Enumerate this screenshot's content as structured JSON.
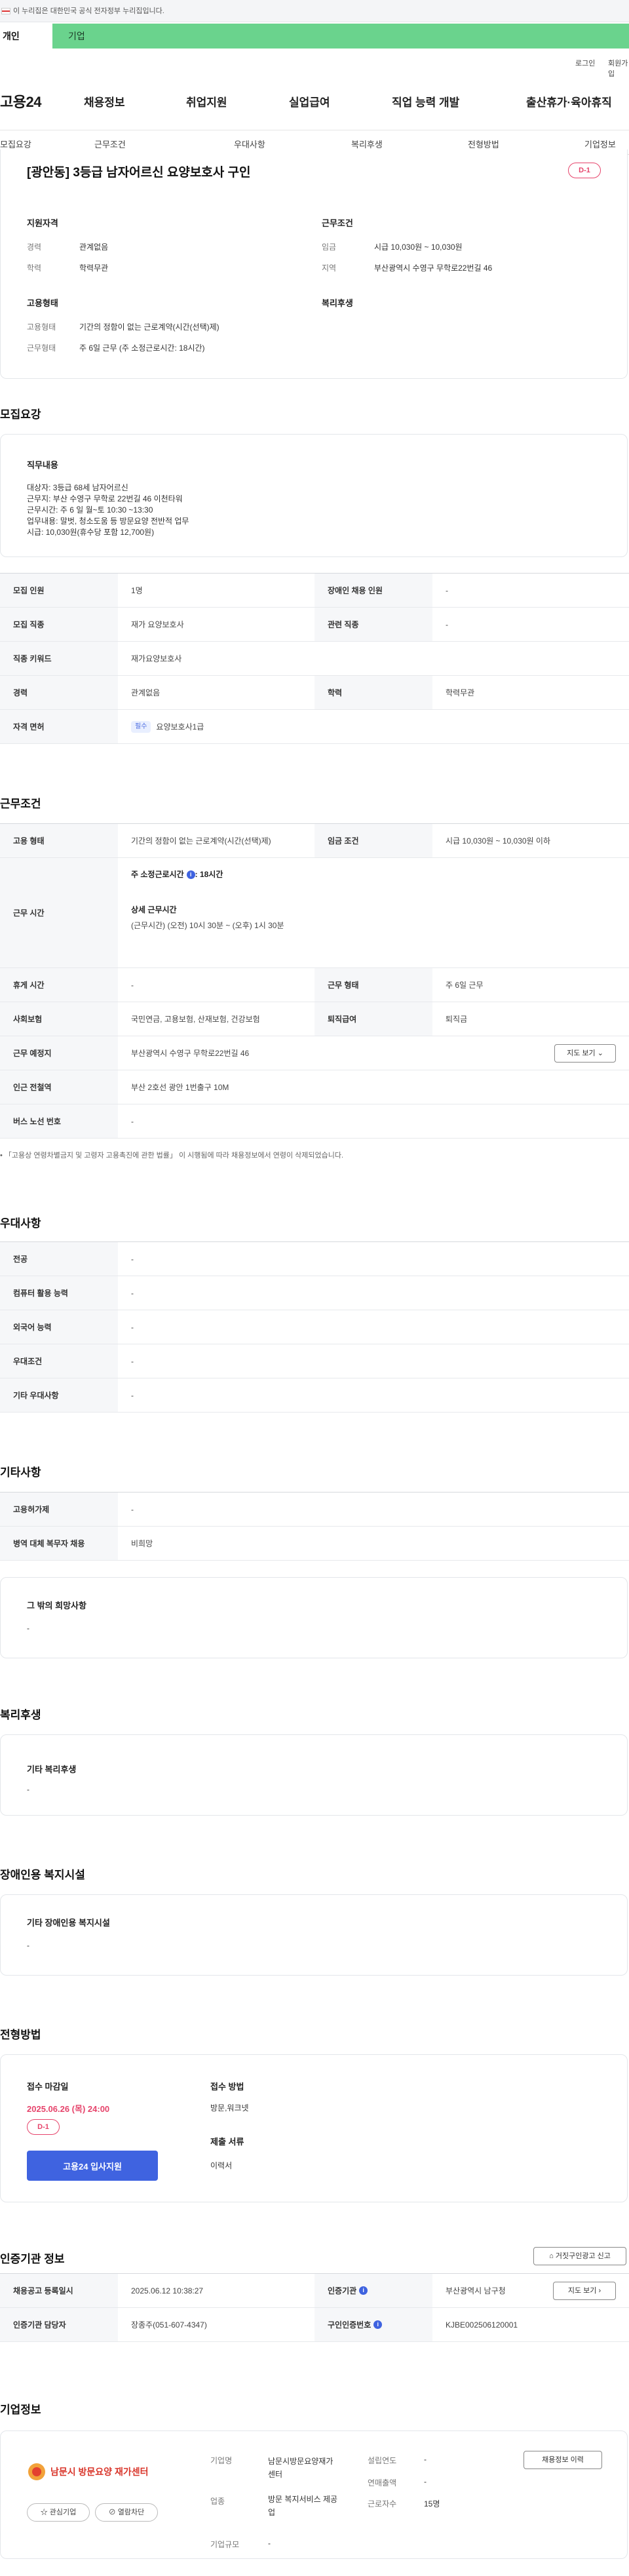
{
  "gov_banner": {
    "text": "이 누리집은 대한민국 공식 전자정부 누리집입니다."
  },
  "user_type_tabs": [
    {
      "label": "개인"
    },
    {
      "label": "기업"
    }
  ],
  "util": {
    "login": "로그인",
    "signup": "회원가입"
  },
  "logo": {
    "text": "고용24"
  },
  "gnb": [
    "채용정보",
    "취업지원",
    "실업급여",
    "직업 능력 개발",
    "출산휴가·육아휴직"
  ],
  "subnav": [
    "모집요강",
    "근무조건",
    "우대사항",
    "복리후생",
    "전형방법",
    "기업정보"
  ],
  "summary": {
    "title": "[광안동] 3등급 남자어르신 요양보호사 구인",
    "dday": "D-1",
    "qual_heading": "지원자격",
    "career_label": "경력",
    "career_value": "관계없음",
    "edu_label": "학력",
    "edu_value": "학력무관",
    "work_heading": "근무조건",
    "wage_label": "임금",
    "wage_value": "시급 10,030원 ~ 10,030원",
    "area_label": "지역",
    "area_value": "부산광역시 수영구 무학로22번길 46",
    "emp_heading": "고용형태",
    "emp_type_label": "고용형태",
    "emp_type_value": "기간의 정함이 없는 근로계약(시간(선택)제)",
    "work_form_label": "근무형태",
    "work_form_value": "주 6일 근무 (주 소정근로시간: 18시간)",
    "welfare_heading": "복리후생"
  },
  "recruit": {
    "section_title": "모집요강",
    "duty_heading": "직무내용",
    "duty_lines": [
      "대상자: 3등급 68세 남자어르신",
      "근무지: 부산 수영구 무학로 22번길 46 이천타워",
      "근무시간: 주 6 일 월~토 10:30 ~13:30",
      "업무내용: 말벗, 청소도움 등 방문요양 전반적 업무",
      "시급: 10,030원(휴수당 포함 12,700원)"
    ],
    "rows": [
      {
        "l1": "모집 인원",
        "v1": "1명",
        "l2": "장애인 채용 인원",
        "v2": "-"
      },
      {
        "l1": "모집 직종",
        "v1": "재가 요양보호사",
        "l2": "관련 직종",
        "v2": "-"
      },
      {
        "l1": "직종 키워드",
        "v1": "재가요양보호사"
      },
      {
        "l1": "경력",
        "v1": "관계없음",
        "l2": "학력",
        "v2": "학력무관"
      },
      {
        "l1": "자격 면허",
        "pill": "필수",
        "v1": "요양보호사1급"
      }
    ]
  },
  "conditions": {
    "section_title": "근무조건",
    "emp_type_label": "고용 형태",
    "emp_type_value": "기간의 정함이 없는 근로계약(시간(선택)제)",
    "wage_label": "임금 조건",
    "wage_value": "시급 10,030원 ~ 10,030원 이하",
    "worktime_label": "근무 시간",
    "weekly_hours": "주 소정근로시간",
    "weekly_hours_value": ": 18시간",
    "detail_heading": "상세 근무시간",
    "detail_value": "(근무시간) (오전) 10시 30분 ~ (오후) 1시 30분",
    "rest_label": "휴게 시간",
    "rest_value": "-",
    "form_label": "근무 형태",
    "form_value": "주 6일 근무",
    "insurance_label": "사회보험",
    "insurance_value": "국민연금, 고용보험, 산재보험, 건강보험",
    "severance_label": "퇴직급여",
    "severance_value": "퇴직금",
    "place_label": "근무 예정지",
    "place_value": "부산광역시 수영구 무학로22번길 46",
    "map_button": "지도 보기",
    "station_label": "인근 전철역",
    "station_value": "부산 2호선 광안 1번출구 10M",
    "bus_label": "버스 노선 번호",
    "bus_value": "-",
    "note": "「고용상 연령차별금지 및 고령자 고용촉진에 관한 법률」 이 시행됨에 따라 채용정보에서 연령이 삭제되었습니다."
  },
  "preference": {
    "section_title": "우대사항",
    "rows": [
      {
        "label": "전공",
        "value": "-"
      },
      {
        "label": "컴퓨터 활용 능력",
        "value": "-"
      },
      {
        "label": "외국어 능력",
        "value": "-"
      },
      {
        "label": "우대조건",
        "value": "-"
      },
      {
        "label": "기타 우대사항",
        "value": "-"
      }
    ]
  },
  "other": {
    "section_title": "기타사항",
    "rows": [
      {
        "label": "고용허가제",
        "value": "-"
      },
      {
        "label": "병역 대체 복무자 채용",
        "value": "비희망"
      }
    ],
    "box_heading": "그 밖의 희망사항",
    "box_value": "-"
  },
  "welfare": {
    "section_title": "복리후생",
    "heading": "기타 복리후생",
    "value": "-"
  },
  "disabled": {
    "section_title": "장애인용 복지시설",
    "heading": "기타 장애인용 복지시설",
    "value": "-"
  },
  "selection": {
    "section_title": "전형방법",
    "deadline_label": "접수 마감일",
    "deadline_value": "2025.06.26 (목) 24:00",
    "dday": "D-1",
    "apply_button": "고용24 입사지원",
    "method_label": "접수 방법",
    "method_value": "방문,워크넷",
    "docs_label": "제출 서류",
    "docs_value": "이력서"
  },
  "agency": {
    "section_title": "인증기관 정보",
    "report_button": "거짓구인광고 신고",
    "reg_label": "채용공고 등록일시",
    "reg_value": "2025.06.12 10:38:27",
    "agency_label": "인증기관",
    "agency_value": "부산광역시 남구청",
    "map_button": "지도 보기",
    "manager_label": "인증기관 담당자",
    "manager_value": "장종주(051-607-4347)",
    "offer_label": "구인인증번호",
    "offer_value": "KJBE002506120001"
  },
  "company": {
    "section_title": "기업정보",
    "logo_text": "남문시 방문요양 재가센터",
    "interest_button": "관심기업",
    "block_button": "열람차단",
    "name_label": "기업명",
    "name_value": "남문시방문요양재가센터",
    "year_label": "설립연도",
    "year_value": "-",
    "sales_label": "연매출액",
    "sales_value": "-",
    "industry_label": "업종",
    "industry_value": "방문 복지서비스 제공업",
    "employees_label": "근로자수",
    "employees_value": "15명",
    "size_label": "기업규모",
    "size_value": "-",
    "history_button": "채용정보 이력"
  },
  "colors": {
    "accent": "#3f63e0",
    "dday": "#e6446b",
    "tab_bar": "#6ad38d"
  }
}
